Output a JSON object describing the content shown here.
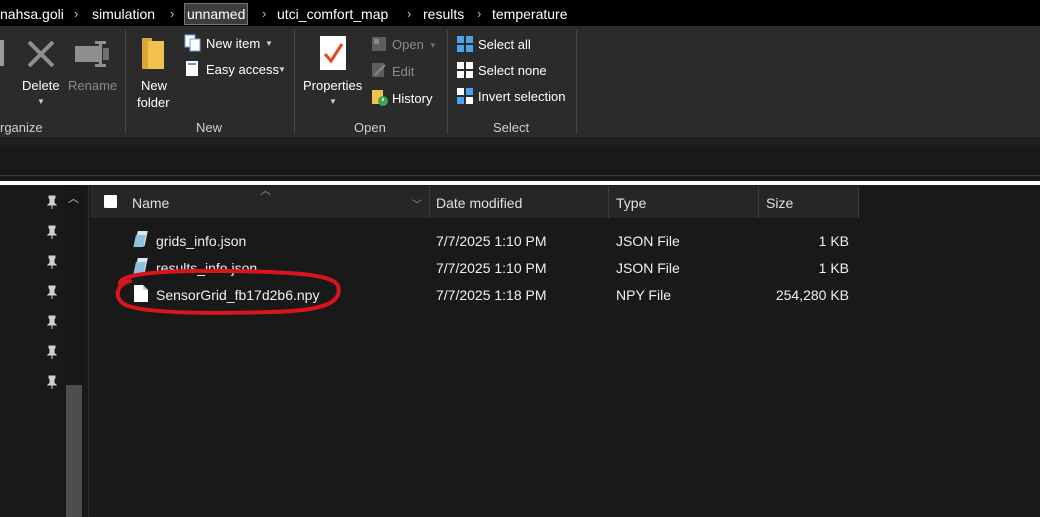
{
  "ribbon": {
    "organize": {
      "delete_label": "Delete",
      "rename_label": "Rename",
      "group_label": "rganize"
    },
    "new": {
      "new_folder_line1": "New",
      "new_folder_line2": "folder",
      "new_item_label": "New item",
      "easy_access_label": "Easy access",
      "group_label": "New"
    },
    "open": {
      "properties_label": "Properties",
      "open_label": "Open",
      "edit_label": "Edit",
      "history_label": "History",
      "group_label": "Open"
    },
    "select": {
      "select_all_label": "Select all",
      "select_none_label": "Select none",
      "invert_selection_label": "Invert selection",
      "group_label": "Select"
    }
  },
  "address": {
    "crumbs": [
      "nahsa.goli",
      "simulation",
      "unnamed",
      "utci_comfort_map",
      "results",
      "temperature"
    ]
  },
  "columns": {
    "name": "Name",
    "date_modified": "Date modified",
    "type": "Type",
    "size": "Size"
  },
  "files": [
    {
      "name": "grids_info.json",
      "date": "7/7/2025 1:10 PM",
      "type": "JSON File",
      "size": "1 KB"
    },
    {
      "name": "results_info.json",
      "date": "7/7/2025 1:10 PM",
      "type": "JSON File",
      "size": "1 KB"
    },
    {
      "name": "SensorGrid_fb17d2b6.npy",
      "date": "7/7/2025 1:18 PM",
      "type": "NPY File",
      "size": "254,280 KB"
    }
  ],
  "colors": {
    "ribbon_bg": "#2b2b2b",
    "list_bg": "#191919",
    "annotation_red": "#d8141c"
  }
}
